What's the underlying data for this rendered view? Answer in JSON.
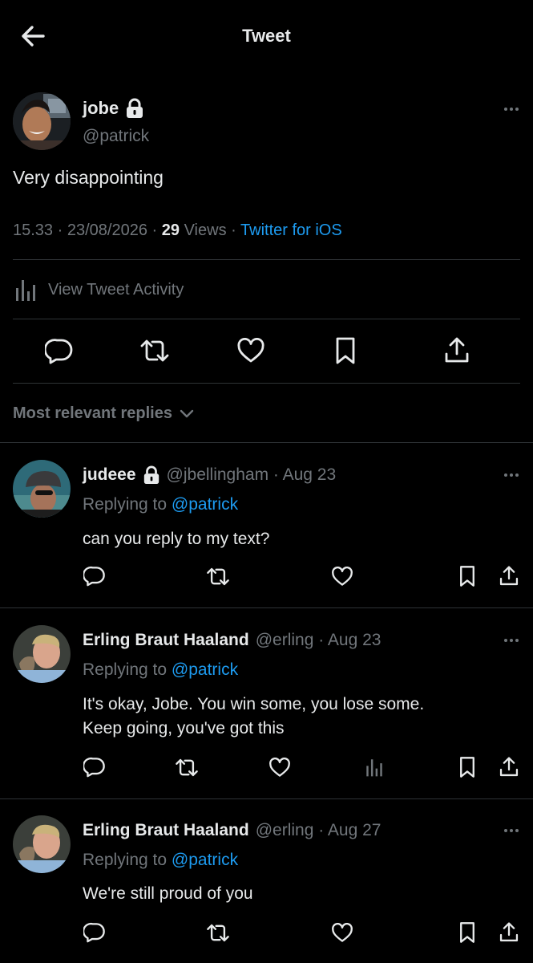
{
  "header": {
    "title": "Tweet"
  },
  "tweet": {
    "name": "jobe",
    "handle": "@patrick",
    "text": "Very disappointing",
    "time": "15.33",
    "date": "23/08/2026",
    "views_count": "29",
    "views_label": "Views",
    "client": "Twitter for iOS",
    "sep": "·",
    "activity_label": "View Tweet Activity"
  },
  "replies_header": {
    "label": "Most relevant replies"
  },
  "replies": [
    {
      "name": "judeee",
      "handle": "@jbellingham · Aug 23",
      "replying_prefix": "Replying to",
      "replying_to": "@patrick",
      "lines": [
        "can you reply to my text?"
      ]
    },
    {
      "name": "Erling Braut Haaland",
      "handle": "@erling · Aug 23",
      "replying_prefix": "Replying to",
      "replying_to": "@patrick",
      "lines": [
        "It's okay, Jobe. You win some, you lose some.",
        "Keep going, you've got this"
      ]
    },
    {
      "name": "Erling Braut Haaland",
      "handle": "@erling · Aug 27",
      "replying_prefix": "Replying to",
      "replying_to": "@patrick",
      "lines": [
        "We're still proud of you"
      ]
    }
  ],
  "colors": {
    "background": "#000000",
    "text": "#e7e9ea",
    "muted": "#71767b",
    "accent": "#1d9bf0",
    "divider": "#2f3336"
  }
}
